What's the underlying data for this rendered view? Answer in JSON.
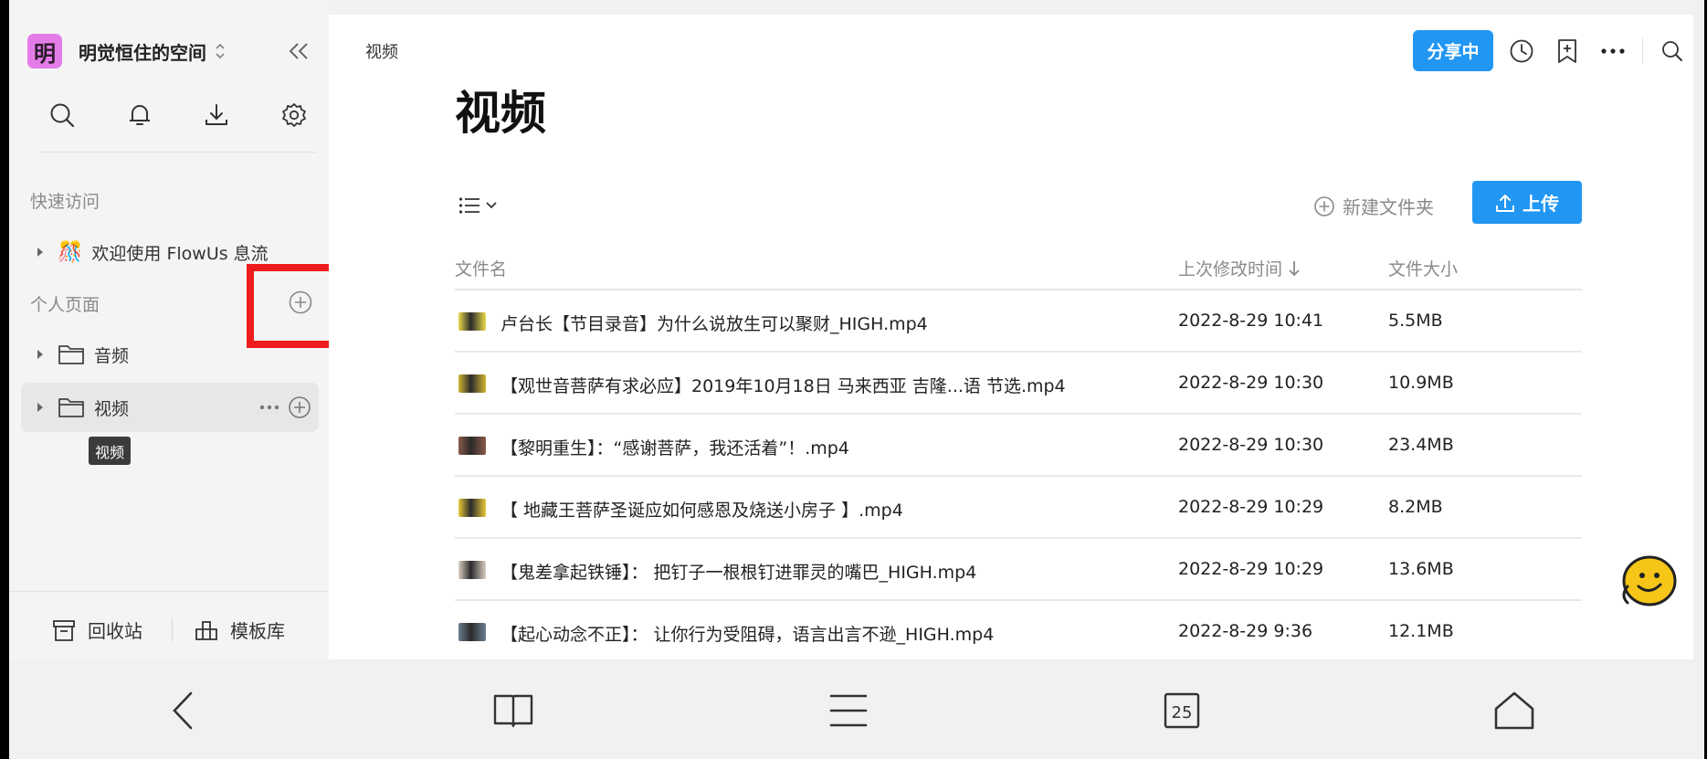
{
  "sidebar": {
    "workspace_avatar": "明",
    "workspace_name": "明觉恒住的空间",
    "quick_access_label": "快速访问",
    "quick_access_items": [
      {
        "emoji": "🎊",
        "label": "欢迎使用 FlowUs 息流"
      }
    ],
    "personal_label": "个人页面",
    "personal_items": [
      {
        "label": "音频"
      },
      {
        "label": "视频"
      }
    ],
    "tooltip": "视频",
    "trash_label": "回收站",
    "templates_label": "模板库"
  },
  "main": {
    "breadcrumb": "视频",
    "share_label": "分享中",
    "title": "视频",
    "new_folder_label": "新建文件夹",
    "upload_label": "上传",
    "columns": {
      "name": "文件名",
      "modified": "上次修改时间",
      "size": "文件大小"
    },
    "files": [
      {
        "name": "卢台长【节目录音】为什么说放生可以聚财_HIGH.mp4",
        "modified": "2022-8-29 10:41",
        "size": "5.5MB",
        "thumb": "#e9d94a"
      },
      {
        "name": "【观世音菩萨有求必应】2019年10月18日 马来西亚 吉隆...语 节选.mp4",
        "modified": "2022-8-29 10:30",
        "size": "10.9MB",
        "thumb": "#d3b534"
      },
      {
        "name": "【黎明重生】：“感谢菩萨，我还活着”！.mp4",
        "modified": "2022-8-29 10:30",
        "size": "23.4MB",
        "thumb": "#8a5a4a"
      },
      {
        "name": "【 地藏王菩萨圣诞应如何感恩及烧送小房子 】.mp4",
        "modified": "2022-8-29 10:29",
        "size": "8.2MB",
        "thumb": "#e8c93a"
      },
      {
        "name": "【鬼差拿起铁锤】：  把钉子一根根钉进罪灵的嘴巴_HIGH.mp4",
        "modified": "2022-8-29 10:29",
        "size": "13.6MB",
        "thumb": "#d9cfc5"
      },
      {
        "name": "【起心动念不正】：  让你行为受阻碍，语言出言不逊_HIGH.mp4",
        "modified": "2022-8-29 9:36",
        "size": "12.1MB",
        "thumb": "#6b7f93"
      }
    ]
  },
  "bottom_nav": {
    "tab_count": "25"
  },
  "colors": {
    "accent": "#2196f3",
    "annotation_red": "#ee1c1c",
    "workspace_avatar": "#e47ce8"
  },
  "icons": [
    "search-icon",
    "bell-icon",
    "download-icon",
    "gear-icon",
    "clock-icon",
    "add-bookmark-icon",
    "more-icon",
    "folder-icon",
    "trash-icon",
    "template-icon",
    "back-icon",
    "book-icon",
    "menu-icon",
    "tabs-icon",
    "home-icon"
  ]
}
